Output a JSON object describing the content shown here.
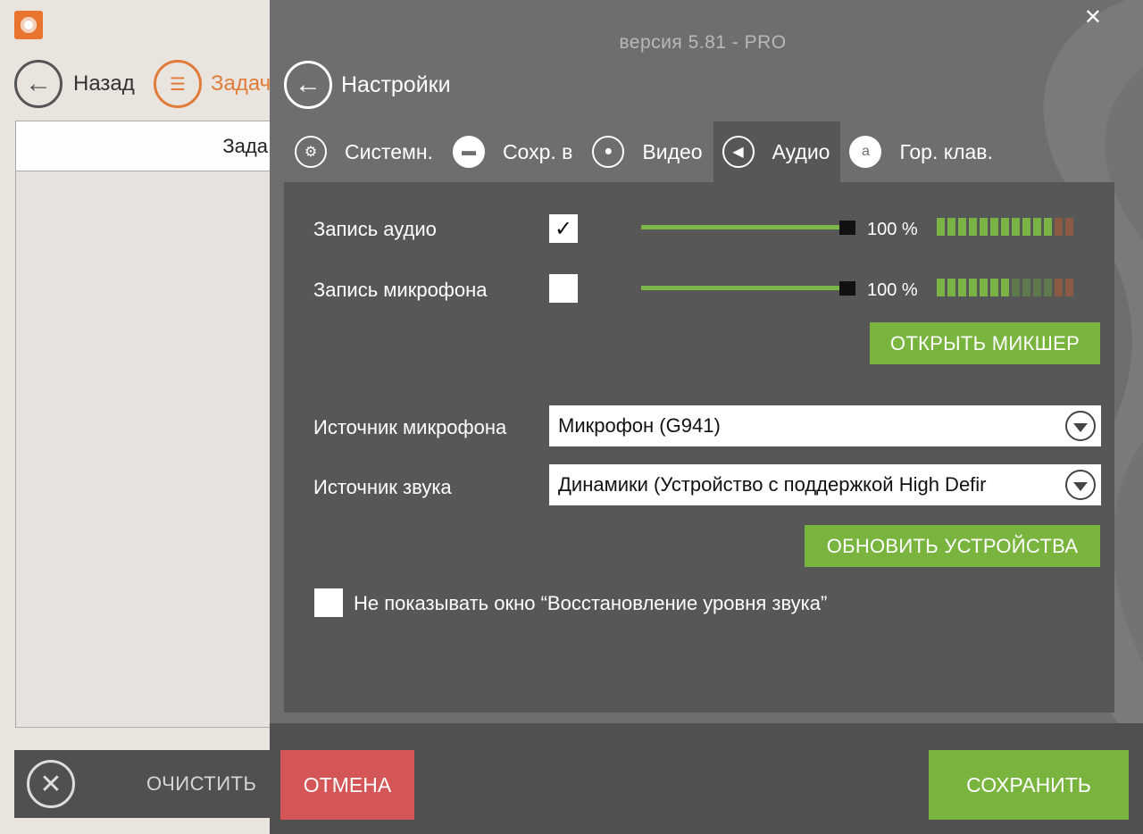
{
  "background_app": {
    "nav": {
      "back_label": "Назад",
      "tasks_label": "Задач"
    },
    "table": {
      "header": "Зада"
    },
    "footer": {
      "clear_label": "ОЧИСТИТЬ"
    }
  },
  "settings": {
    "version": "версия 5.81 - PRO",
    "title": "Настройки",
    "tabs": [
      {
        "label": "Системн.",
        "icon": "gears-icon",
        "active": false
      },
      {
        "label": "Сохр. в",
        "icon": "folder-icon",
        "active": false
      },
      {
        "label": "Видео",
        "icon": "record-icon",
        "active": false
      },
      {
        "label": "Аудио",
        "icon": "speaker-icon",
        "active": true
      },
      {
        "label": "Гор. клав.",
        "icon": "hotkey-icon",
        "active": false
      }
    ],
    "audio": {
      "record_audio": {
        "label": "Запись аудио",
        "checked": true,
        "volume_text": "100 %",
        "volume": 1.0,
        "meter_level": 0.8
      },
      "record_mic": {
        "label": "Запись микрофона",
        "checked": false,
        "volume_text": "100 %",
        "volume": 1.0,
        "meter_level": 0.5
      },
      "open_mixer_label": "ОТКРЫТЬ МИКШЕР",
      "mic_source": {
        "label": "Источник микрофона",
        "value": "Микрофон (G941)"
      },
      "sound_source": {
        "label": "Источник звука",
        "value": "Динамики (Устройство с поддержкой High Defir"
      },
      "refresh_devices_label": "ОБНОВИТЬ УСТРОЙСТВА",
      "dont_show": {
        "label": "Не показывать окно “Восстановление уровня звука”",
        "checked": false
      }
    },
    "footer": {
      "cancel_label": "ОТМЕНА",
      "save_label": "СОХРАНИТЬ"
    }
  },
  "colors": {
    "accent_green": "#79b43e",
    "cancel_red": "#d45656",
    "panel_grey": "#6e6e6e",
    "content_grey": "#575757",
    "brand_orange": "#e07b39"
  }
}
